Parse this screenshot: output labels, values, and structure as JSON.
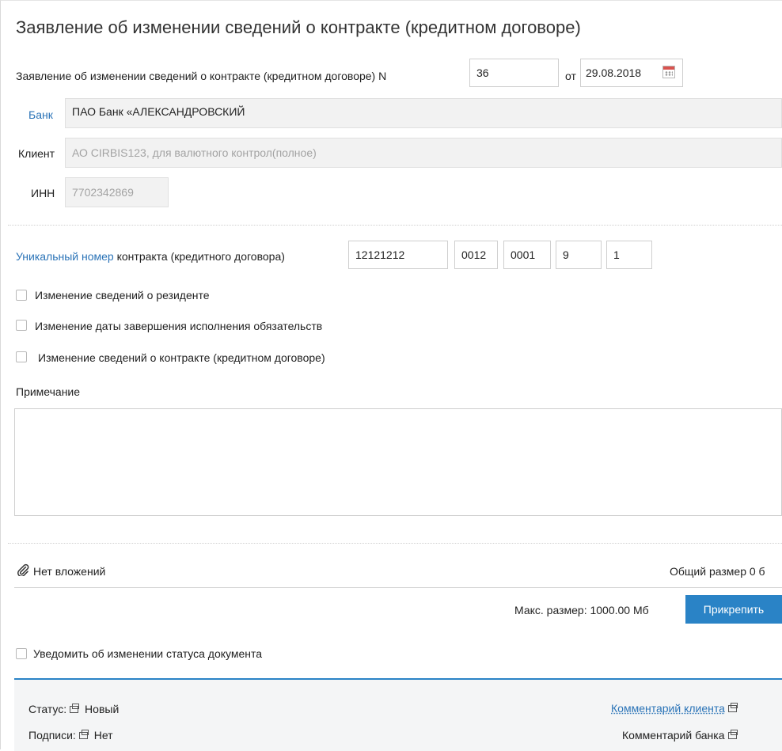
{
  "header": {
    "title": "Заявление об изменении сведений о контракте (кредитном договоре)"
  },
  "statement": {
    "label": "Заявление об изменении сведений о контракте (кредитном договоре) N",
    "number": "36",
    "date_prefix": "от",
    "date": "29.08.2018"
  },
  "bank": {
    "label": "Банк",
    "value": "ПАО Банк «АЛЕКСАНДРОВСКИЙ"
  },
  "client": {
    "label": "Клиент",
    "value": "АО CIRBIS123, для валютного контрол(полное)"
  },
  "inn": {
    "label": "ИНН",
    "value": "7702342869"
  },
  "unique_number": {
    "link_label": "Уникальный номер",
    "label_rest": "контракта (кредитного договора)",
    "parts": [
      "12121212",
      "0012",
      "0001",
      "9",
      "1"
    ]
  },
  "checkboxes": [
    {
      "label": "Изменение сведений о резиденте",
      "checked": false
    },
    {
      "label": "Изменение даты завершения исполнения обязательств",
      "checked": false
    },
    {
      "label": "Изменение сведений о контракте (кредитном договоре)",
      "checked": false
    }
  ],
  "note": {
    "label": "Примечание",
    "value": ""
  },
  "attachments": {
    "none_label": "Нет вложений",
    "total_size": "Общий размер 0 б",
    "max_size": "Макс. размер: 1000.00 Мб",
    "attach_button": "Прикрепить"
  },
  "notify": {
    "label": "Уведомить об изменении статуса документа",
    "checked": false
  },
  "footer": {
    "status_label": "Статус:",
    "status_value": "Новый",
    "signatures_label": "Подписи:",
    "signatures_value": "Нет",
    "client_comment": "Комментарий клиента",
    "bank_comment": "Комментарий банка"
  },
  "colors": {
    "accent": "#2a83c6",
    "link": "#2a73b7"
  }
}
